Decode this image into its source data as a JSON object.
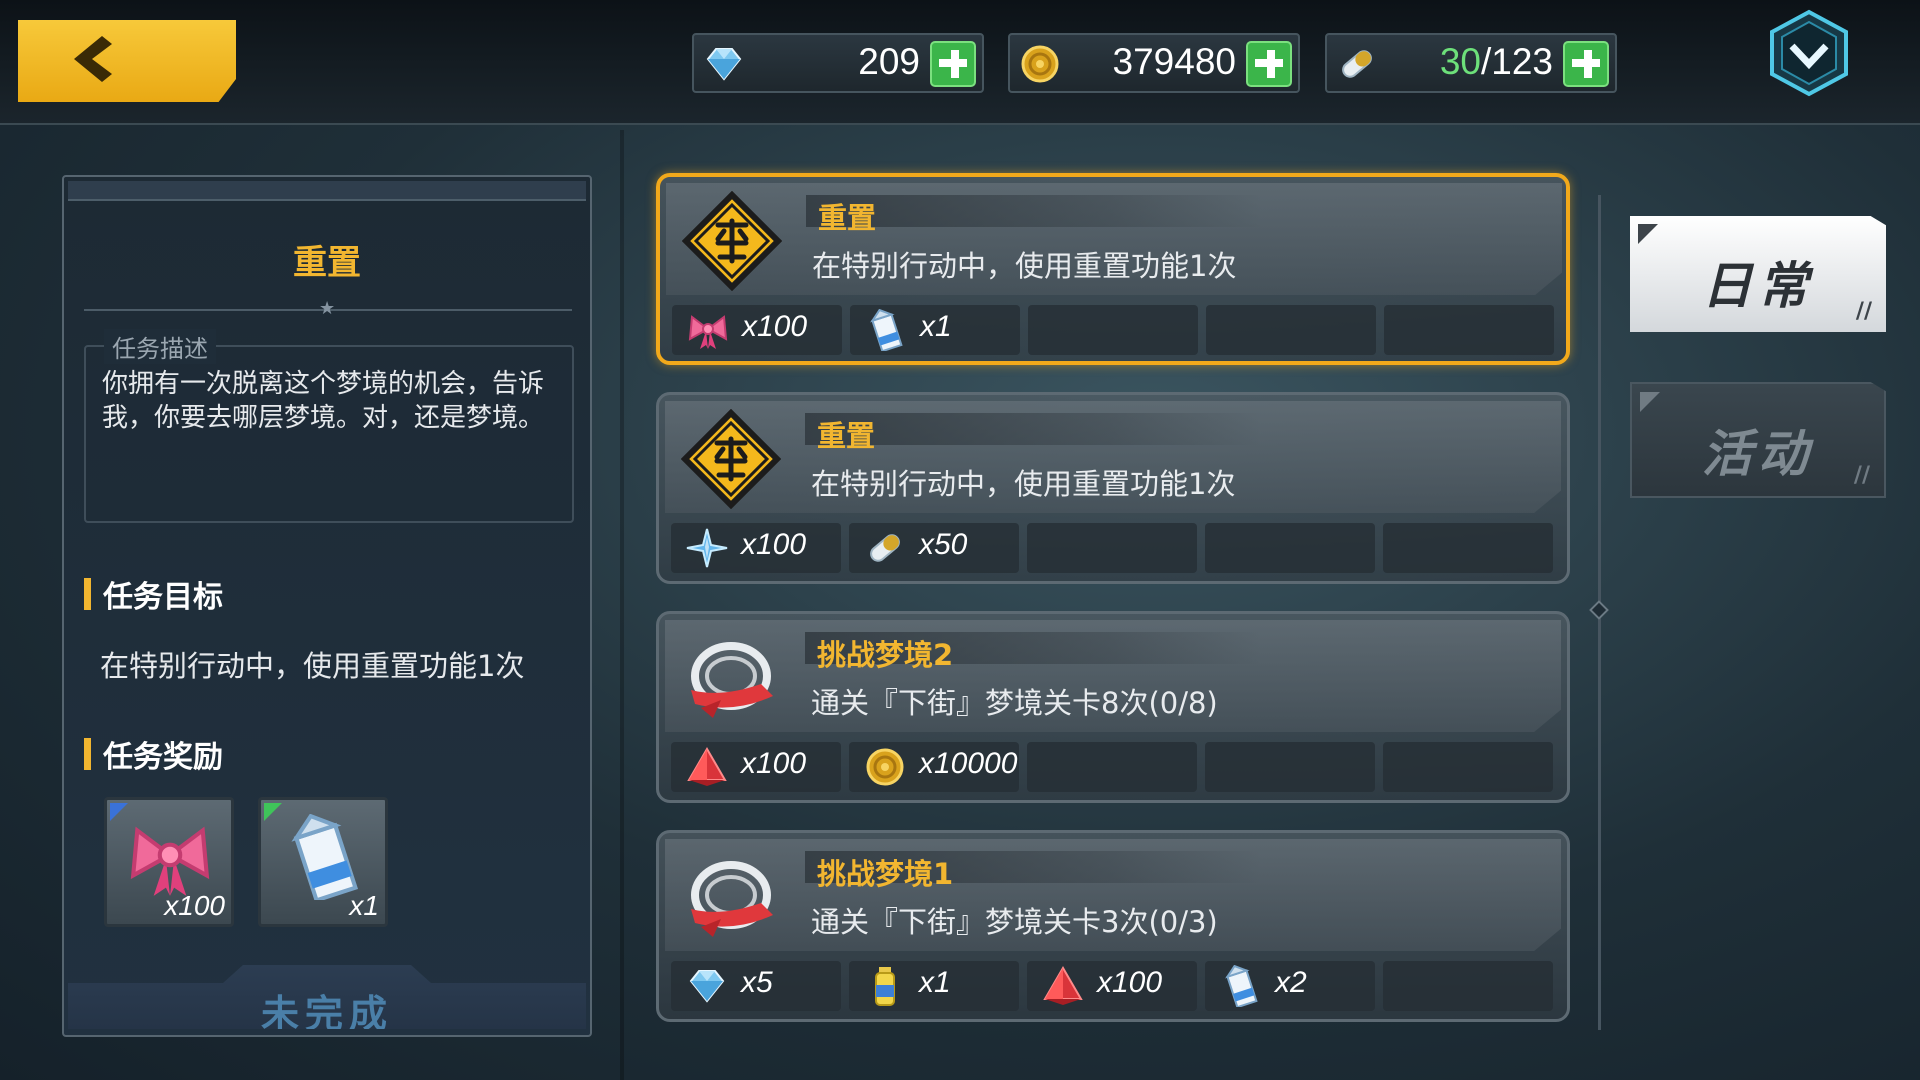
{
  "currencies": {
    "gems": {
      "value": "209",
      "icon": "gem-icon"
    },
    "coins": {
      "value": "379480",
      "icon": "coin-icon"
    },
    "stamina": {
      "current": "30",
      "max": "/123",
      "icon": "stamina-pill-icon"
    }
  },
  "detail": {
    "title": "重置",
    "desc_label": "任务描述",
    "description": "你拥有一次脱离这个梦境的机会，告诉我，你要去哪层梦境。对，还是梦境。",
    "goal_heading": "任务目标",
    "goal_text": "在特别行动中，使用重置功能1次",
    "reward_heading": "任务奖励",
    "rewards": [
      {
        "icon": "ribbon-icon",
        "qty": "x100"
      },
      {
        "icon": "milk-carton-icon",
        "qty": "x1"
      }
    ],
    "status": "未完成"
  },
  "missions": [
    {
      "title": "重置",
      "desc": "在特别行动中，使用重置功能1次",
      "icon": "reset-emblem-icon",
      "rewards": [
        {
          "icon": "ribbon-icon",
          "qty": "x100"
        },
        {
          "icon": "milk-carton-icon",
          "qty": "x1"
        }
      ]
    },
    {
      "title": "重置",
      "desc": "在特别行动中，使用重置功能1次",
      "icon": "reset-emblem-icon",
      "rewards": [
        {
          "icon": "crystal-shard-icon",
          "qty": "x100"
        },
        {
          "icon": "stamina-pill-icon",
          "qty": "x50"
        }
      ]
    },
    {
      "title": "挑战梦境2",
      "desc": "通关『下街』梦境关卡8次(0/8)",
      "icon": "dream-ring-icon",
      "rewards": [
        {
          "icon": "red-crystal-icon",
          "qty": "x100"
        },
        {
          "icon": "coin-icon",
          "qty": "x10000"
        }
      ]
    },
    {
      "title": "挑战梦境1",
      "desc": "通关『下街』梦境关卡3次(0/3)",
      "icon": "dream-ring-icon",
      "rewards": [
        {
          "icon": "gem-icon",
          "qty": "x5"
        },
        {
          "icon": "exp-bottle-icon",
          "qty": "x1"
        },
        {
          "icon": "red-crystal-icon",
          "qty": "x100"
        },
        {
          "icon": "milk-carton-icon",
          "qty": "x2"
        }
      ]
    }
  ],
  "tabs": [
    {
      "label": "日常",
      "active": true
    },
    {
      "label": "活动",
      "active": false
    }
  ],
  "colors": {
    "accent_gold": "#f2b630",
    "selected_border": "#f2a91b",
    "plus_green": "#3bb54a",
    "status_blue": "#4a7fa8"
  }
}
